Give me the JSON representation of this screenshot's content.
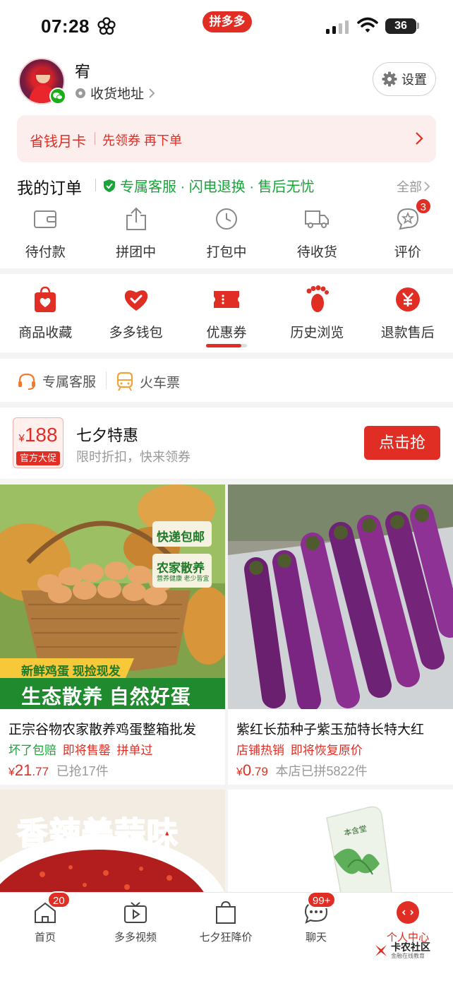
{
  "status_bar": {
    "time": "07:28",
    "app_badge": "拼多多",
    "battery": "36"
  },
  "profile": {
    "username": "宥",
    "address_label": "收货地址",
    "settings_label": "设置"
  },
  "promo": {
    "title": "省钱月卡",
    "subtitle": "先领券 再下单"
  },
  "orders": {
    "title": "我的订单",
    "tag": "专属客服 · 闪电退换 · 售后无忧",
    "all_label": "全部",
    "items": [
      {
        "label": "待付款",
        "icon": "wallet-icon"
      },
      {
        "label": "拼团中",
        "icon": "share-box-icon"
      },
      {
        "label": "打包中",
        "icon": "clock-icon"
      },
      {
        "label": "待收货",
        "icon": "truck-icon"
      },
      {
        "label": "评价",
        "icon": "review-icon",
        "badge": "3"
      }
    ]
  },
  "tools": {
    "items": [
      {
        "label": "商品收藏",
        "icon": "favorites-bag-icon"
      },
      {
        "label": "多多钱包",
        "icon": "wallet-heart-icon"
      },
      {
        "label": "优惠券",
        "icon": "coupon-icon"
      },
      {
        "label": "历史浏览",
        "icon": "footprint-icon"
      },
      {
        "label": "退款售后",
        "icon": "refund-icon"
      }
    ]
  },
  "services": [
    {
      "label": "专属客服",
      "icon": "headset-icon"
    },
    {
      "label": "火车票",
      "icon": "train-icon"
    }
  ],
  "flash_sale": {
    "coupon_currency": "¥",
    "coupon_amount": "188",
    "coupon_tag": "官方大促",
    "title": "七夕特惠",
    "subtitle": "限时折扣，快来领券",
    "button": "点击抢"
  },
  "products": [
    {
      "image_labels": {
        "tag1": "快递包邮",
        "tag2": "农家散养",
        "tag2_sub": "营养健康 老少皆宜",
        "strip": "新鲜鸡蛋 现捡现发",
        "banner": "生态散养 自然好蛋"
      },
      "title": "正宗谷物农家散养鸡蛋整箱批发",
      "tags": [
        {
          "text": "坏了包赔",
          "color": "#1aa33a"
        },
        {
          "text": "即将售罄",
          "color": "#e02e24"
        },
        {
          "text": "拼单过",
          "color": "#e02e24"
        }
      ],
      "currency": "¥",
      "price_int": "21",
      "price_dec": ".77",
      "sold": "已抢17件"
    },
    {
      "title": "紫红长茄种子紫玉茄特长特大红",
      "tags": [
        {
          "text": "店铺热销",
          "color": "#e02e24"
        },
        {
          "text": "即将恢复原价",
          "color": "#e02e24"
        }
      ],
      "currency": "¥",
      "price_int": "0",
      "price_dec": ".79",
      "sold": "本店已拼5822件"
    },
    {
      "image_text": "香辣姜蒜味"
    },
    {
      "image_text": "本含堂"
    }
  ],
  "tabbar": [
    {
      "label": "首页",
      "icon": "home-icon",
      "badge": "20"
    },
    {
      "label": "多多视频",
      "icon": "video-icon"
    },
    {
      "label": "七夕狂降价",
      "icon": "shopping-bag-icon"
    },
    {
      "label": "聊天",
      "icon": "chat-icon",
      "badge": "99+"
    },
    {
      "label": "个人中心",
      "icon": "profile-center-icon",
      "active": true
    }
  ],
  "watermark": {
    "main": "卡农社区",
    "sub": "金融在线教育"
  },
  "colors": {
    "brand_red": "#e02e24",
    "green": "#1aa33a",
    "promo_bg": "#fdeeee"
  }
}
